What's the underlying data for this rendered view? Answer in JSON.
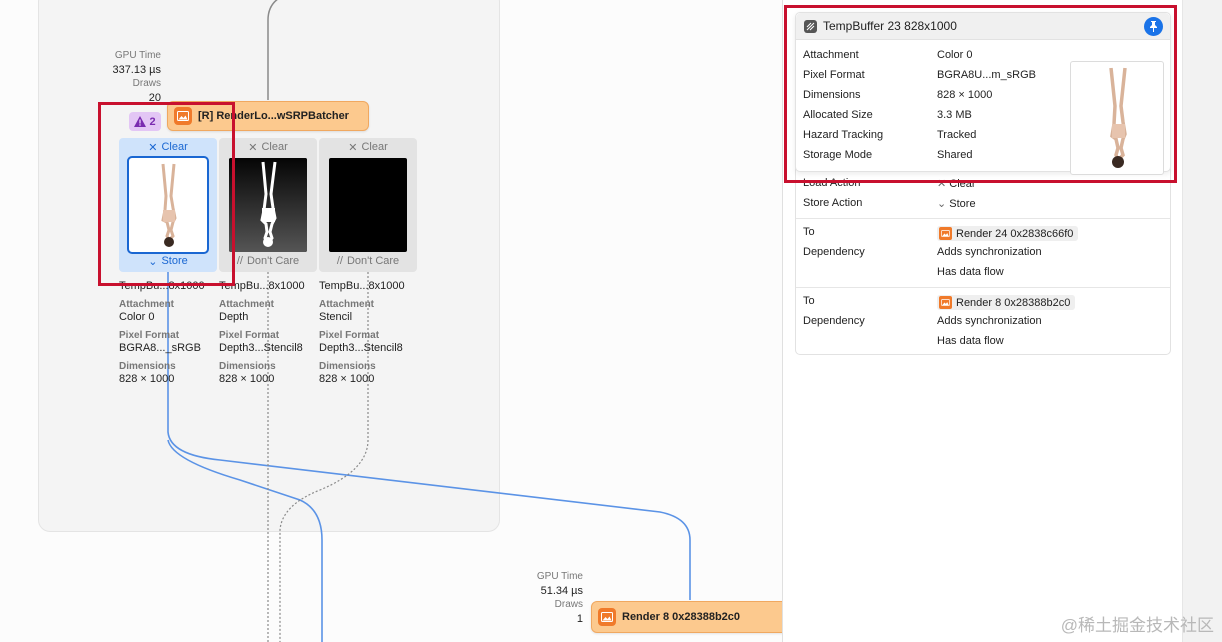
{
  "canvas": {
    "top_pass": {
      "gpu_time_label": "GPU Time",
      "gpu_time_value": "337.13 µs",
      "draws_label": "Draws",
      "draws_value": "20",
      "warning_count": "2",
      "name": "[R] RenderLo...wSRPBatcher"
    },
    "attachments": [
      {
        "load_action": "Clear",
        "store_action": "Store",
        "title": "TempBu...8x1000",
        "attachment_label": "Attachment",
        "attachment_value": "Color 0",
        "pixel_format_label": "Pixel Format",
        "pixel_format_value": "BGRA8..._sRGB",
        "dimensions_label": "Dimensions",
        "dimensions_value": "828 × 1000"
      },
      {
        "load_action": "Clear",
        "store_action": "Don't Care",
        "title": "TempBu...8x1000",
        "attachment_label": "Attachment",
        "attachment_value": "Depth",
        "pixel_format_label": "Pixel Format",
        "pixel_format_value": "Depth3...Stencil8",
        "dimensions_label": "Dimensions",
        "dimensions_value": "828 × 1000"
      },
      {
        "load_action": "Clear",
        "store_action": "Don't Care",
        "title": "TempBu...8x1000",
        "attachment_label": "Attachment",
        "attachment_value": "Stencil",
        "pixel_format_label": "Pixel Format",
        "pixel_format_value": "Depth3...Stencil8",
        "dimensions_label": "Dimensions",
        "dimensions_value": "828 × 1000"
      }
    ],
    "bottom_pass": {
      "gpu_time_label": "GPU Time",
      "gpu_time_value": "51.34 µs",
      "draws_label": "Draws",
      "draws_value": "1",
      "name": "Render 8 0x28388b2c0"
    }
  },
  "inspector": {
    "title": "TempBuffer 23 828x1000",
    "properties": [
      {
        "key": "Attachment",
        "value": "Color 0"
      },
      {
        "key": "Pixel Format",
        "value": "BGRA8U...m_sRGB"
      },
      {
        "key": "Dimensions",
        "value": "828 × 1000"
      },
      {
        "key": "Allocated Size",
        "value": "3.3 MB"
      },
      {
        "key": "Hazard Tracking",
        "value": "Tracked"
      },
      {
        "key": "Storage Mode",
        "value": "Shared"
      }
    ],
    "load_action_label": "Load Action",
    "load_action_value": "Clear",
    "store_action_label": "Store Action",
    "store_action_value": "Store",
    "dependencies": [
      {
        "to_label": "To",
        "to_value": "Render 24 0x2838c66f0",
        "dependency_label": "Dependency",
        "dependency_value": "Adds synchronization",
        "flow_value": "Has data flow"
      },
      {
        "to_label": "To",
        "to_value": "Render 8 0x28388b2c0",
        "dependency_label": "Dependency",
        "dependency_value": "Adds synchronization",
        "flow_value": "Has data flow"
      }
    ]
  },
  "colors": {
    "selection_blue": "#1a67d2",
    "pass_orange": "#fcc98e",
    "highlight_red": "#c8102e",
    "wire_blue": "#5b93e6"
  },
  "watermark": "@稀土掘金技术社区"
}
